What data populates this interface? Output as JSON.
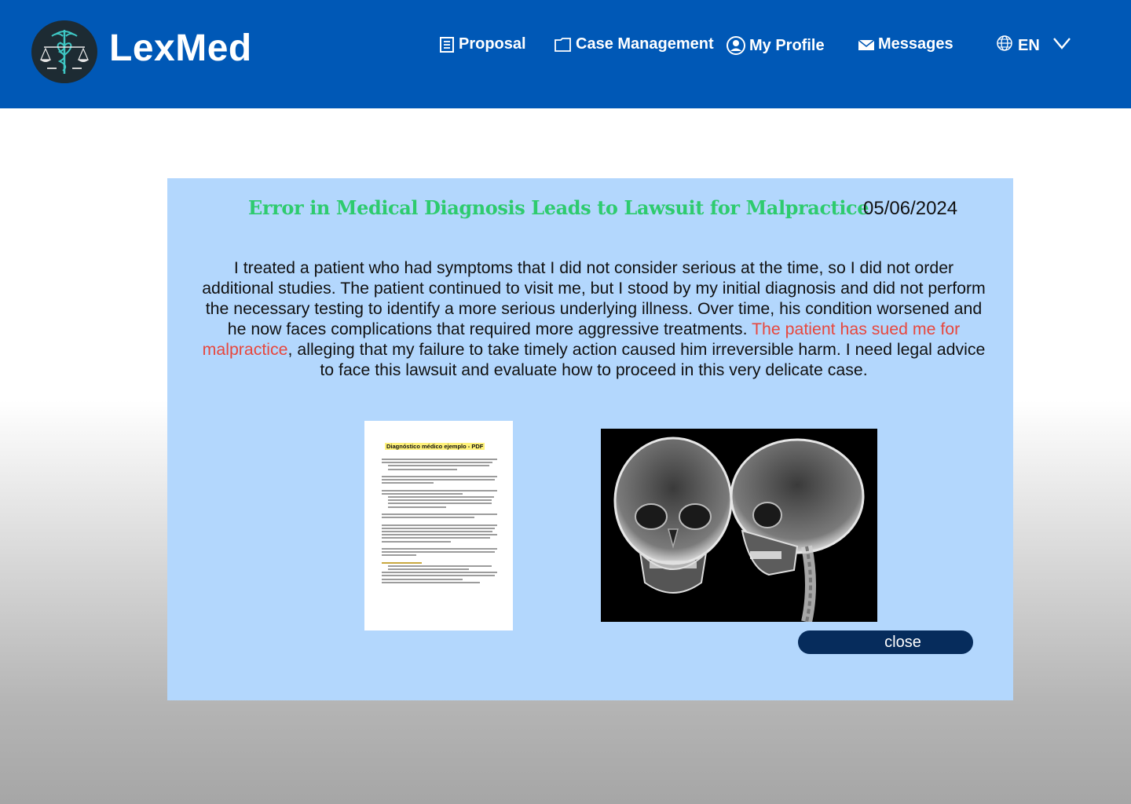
{
  "header": {
    "brand": "LexMed",
    "logo_icon": "caduceus-scales-logo-icon",
    "nav": [
      {
        "label": "Proposal",
        "icon": "document-icon"
      },
      {
        "label": "Case Management",
        "icon": "folder-icon"
      },
      {
        "label": "My Profile",
        "icon": "user-circle-icon"
      },
      {
        "label": "Messages",
        "icon": "envelope-icon"
      }
    ],
    "language": {
      "value": "EN",
      "icon": "globe-icon",
      "dropdown_icon": "chevron-down-icon"
    },
    "background": "#0058b6"
  },
  "modal": {
    "title": "Error in Medical Diagnosis Leads to Lawsuit for Malpractice",
    "date": "05/06/2024",
    "description_pre": "I treated a patient who had symptoms that I did not consider serious at the time, so I did not order additional studies. The patient continued to visit me, but I stood by my initial diagnosis and did not perform the necessary testing to identify a more serious underlying illness. Over time, his condition worsened and he now faces complications that required more aggressive treatments. ",
    "description_highlight": "The patient has sued me for malpractice",
    "description_post": ", alleging that my failure to take timely action caused him irreversible harm. I need legal advice to face this lawsuit and evaluate how to proceed in this very delicate case.",
    "attachments": {
      "document_title": "Diagnóstico médico ejemplo - PDF",
      "image_description": "skull-xray-image"
    },
    "close_label": "close",
    "colors": {
      "title": "#2ecb6e",
      "highlight": "#e7473d",
      "background": "#b3d7fd",
      "close_button": "#062c5c"
    }
  }
}
